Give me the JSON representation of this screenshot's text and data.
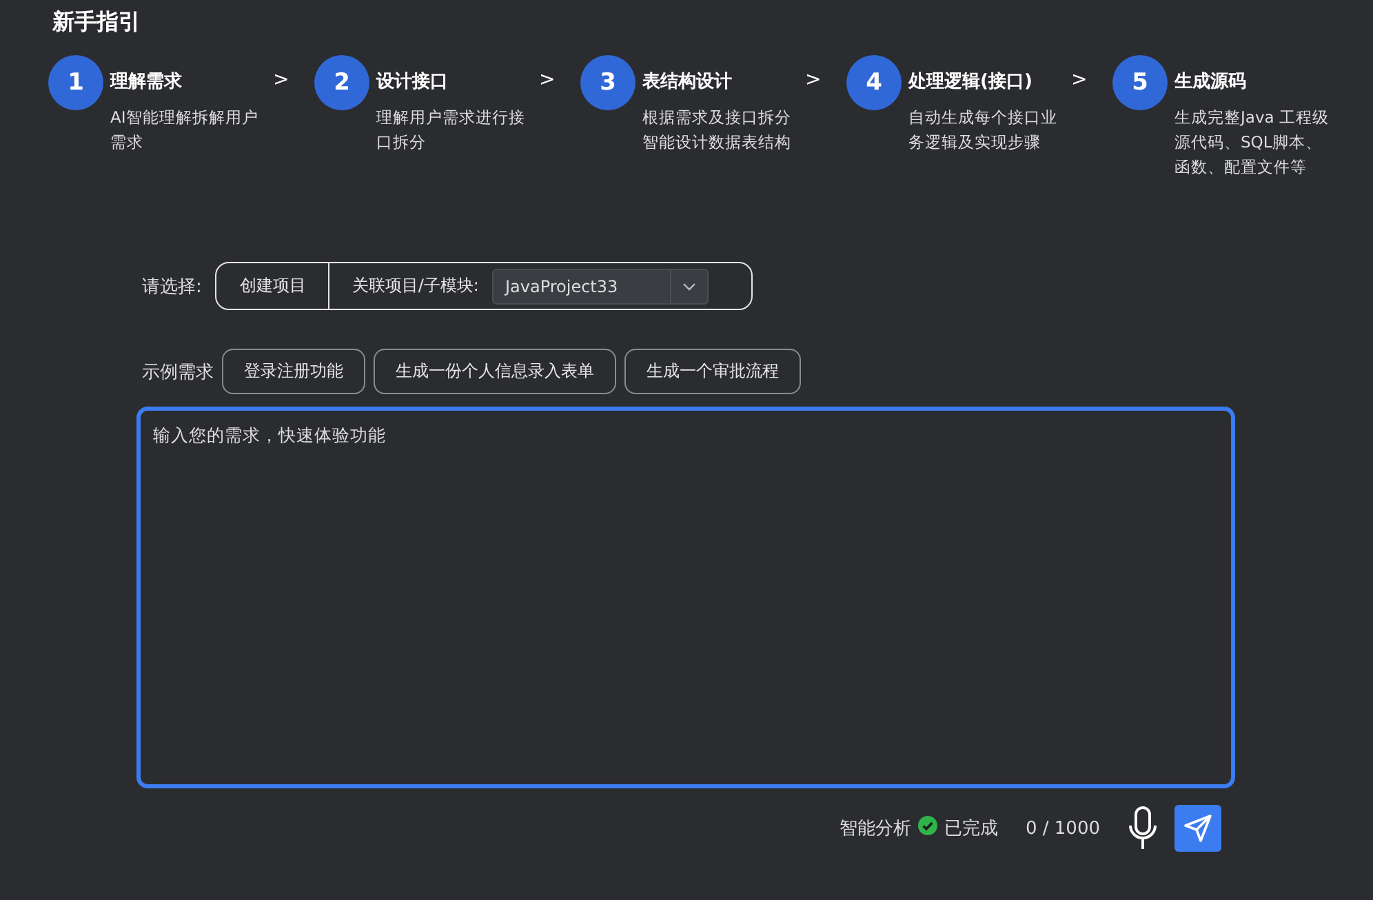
{
  "title": "新手指引",
  "steps": [
    {
      "number": "1",
      "title": "理解需求",
      "description": "AI智能理解拆解用户需求",
      "separator": ">"
    },
    {
      "number": "2",
      "title": "设计接口",
      "description": "理解用户需求进行接口拆分",
      "separator": ">"
    },
    {
      "number": "3",
      "title": "表结构设计",
      "description": "根据需求及接口拆分智能设计数据表结构",
      "separator": ">"
    },
    {
      "number": "4",
      "title": "处理逻辑(接口)",
      "description": "自动生成每个接口业务逻辑及实现步骤",
      "separator": ">"
    },
    {
      "number": "5",
      "title": "生成源码",
      "description": "生成完整Java 工程级源代码、SQL脚本、函数、配置文件等"
    }
  ],
  "project_select": {
    "label": "请选择:",
    "create_button": "创建项目",
    "link_label": "关联项目/子模块:",
    "dropdown_value": "JavaProject33"
  },
  "examples": {
    "label": "示例需求",
    "chips": [
      "登录注册功能",
      "生成一份个人信息录入表单",
      "生成一个审批流程"
    ]
  },
  "input": {
    "placeholder": "输入您的需求，快速体验功能",
    "focused": true
  },
  "footer": {
    "analysis_label": "智能分析",
    "analysis_done": true,
    "analysis_status": "已完成",
    "counter": "0 / 1000"
  }
}
